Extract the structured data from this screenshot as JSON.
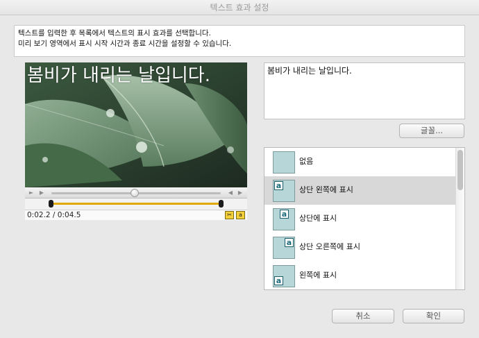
{
  "window": {
    "title": "텍스트 효과 설정"
  },
  "instructions": {
    "line1": "텍스트를 입력한 후 목록에서 텍스트의 표시 효과를 선택합니다.",
    "line2": "미리 보기 영역에서 표시 시작 시간과 종료 시간을 설정할 수 있습니다."
  },
  "preview": {
    "overlay_text": "봄비가 내리는 날입니다.",
    "time_readout": "0:02.2 / 0:04.5",
    "playhead_fraction": 0.49
  },
  "text_field": {
    "value": "봄비가 내리는 날입니다."
  },
  "font_button": {
    "label": "글꼴..."
  },
  "effects": {
    "items": [
      {
        "label": "없음",
        "position": "none",
        "selected": false
      },
      {
        "label": "상단 왼쪽에 표시",
        "position": "top-left",
        "selected": true
      },
      {
        "label": "상단에 표시",
        "position": "top",
        "selected": false
      },
      {
        "label": "상단 오른쪽에 표시",
        "position": "top-right",
        "selected": false
      },
      {
        "label": "왼쪽에 표시",
        "position": "left",
        "selected": false
      }
    ],
    "thumb_glyph": "a"
  },
  "footer": {
    "cancel_label": "취소",
    "ok_label": "확인"
  },
  "colors": {
    "trim_accent": "#e0a800",
    "thumb_fill": "#b7d6d8",
    "selection": "#d8d8d8"
  }
}
